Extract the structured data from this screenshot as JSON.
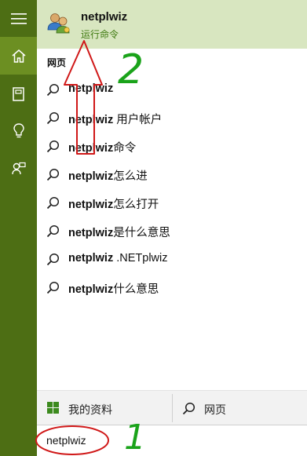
{
  "top_result": {
    "title": "netplwiz",
    "subtitle": "运行命令",
    "icon": "users-accounts-icon"
  },
  "section_label": "网页",
  "suggestions": [
    {
      "bold": "netplwiz",
      "rest": ""
    },
    {
      "bold": "netplwiz",
      "rest": " 用户帐户"
    },
    {
      "bold": "netplwiz",
      "rest": "命令"
    },
    {
      "bold": "netplwiz",
      "rest": "怎么进"
    },
    {
      "bold": "netplwiz",
      "rest": "怎么打开"
    },
    {
      "bold": "netplwiz",
      "rest": "是什么意思"
    },
    {
      "bold": "netplwiz",
      "rest": " .NETplwiz"
    },
    {
      "bold": "netplwiz",
      "rest": "什么意思"
    }
  ],
  "bottom_bar": {
    "my_stuff_label": "我的资料",
    "web_label": "网页"
  },
  "search_box": {
    "value": "netplwiz"
  },
  "annotations": {
    "step_one": "1",
    "step_two": "2",
    "color": "#1aa31a",
    "red": "#d01818"
  },
  "colors": {
    "rail": "#4d6e14",
    "rail_active": "#6c8f22",
    "top_result_bg": "#d8e6c0",
    "subtitle": "#3f7a10"
  }
}
